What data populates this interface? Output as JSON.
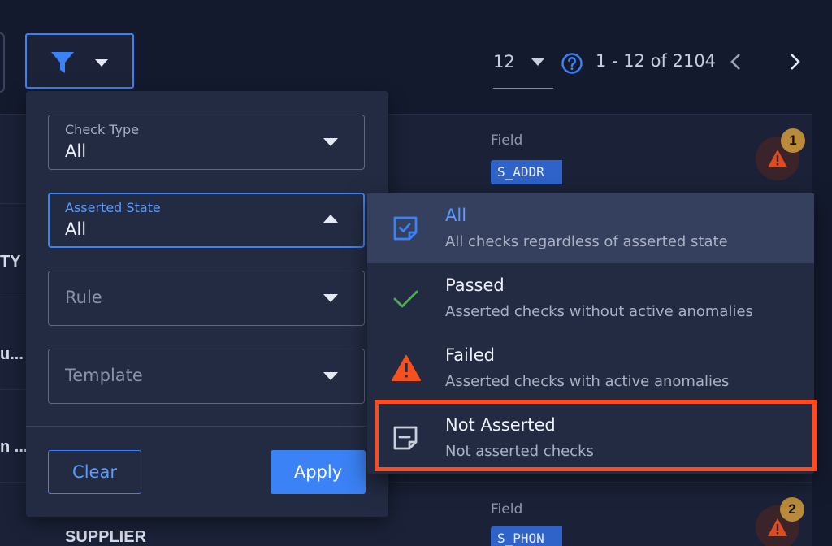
{
  "toolbar": {
    "filter_button_icon": "funnel-icon",
    "page_size": "12",
    "range_text": "1 - 12 of 2104"
  },
  "background_rows": {
    "edge_texts": [
      "TY",
      "u...",
      "n ..."
    ],
    "field_label": "Field",
    "row1_field_value": "S_ADDR",
    "row1_anomaly_count": "1",
    "row5_field_value": "S_PHON",
    "row5_anomaly_count": "2",
    "row5_title": "SUPPLIER"
  },
  "filter_panel": {
    "check_type": {
      "label": "Check Type",
      "value": "All"
    },
    "asserted_state": {
      "label": "Asserted State",
      "value": "All"
    },
    "rule": {
      "placeholder": "Rule"
    },
    "template": {
      "placeholder": "Template"
    },
    "clear_label": "Clear",
    "apply_label": "Apply"
  },
  "asserted_state_menu": {
    "items": [
      {
        "title": "All",
        "description": "All checks regardless of asserted state",
        "icon": "checkbox-icon"
      },
      {
        "title": "Passed",
        "description": "Asserted checks without active anomalies",
        "icon": "check-icon"
      },
      {
        "title": "Failed",
        "description": "Asserted checks with active anomalies",
        "icon": "warning-icon"
      },
      {
        "title": "Not Asserted",
        "description": "Not asserted checks",
        "icon": "note-icon"
      }
    ]
  },
  "colors": {
    "background": "#141a2e",
    "panel": "#232b43",
    "accent": "#3b82f6",
    "passed": "#4caf50",
    "failed": "#f4511e",
    "highlight": "#ff4a1c",
    "badge": "#b88a3a"
  }
}
